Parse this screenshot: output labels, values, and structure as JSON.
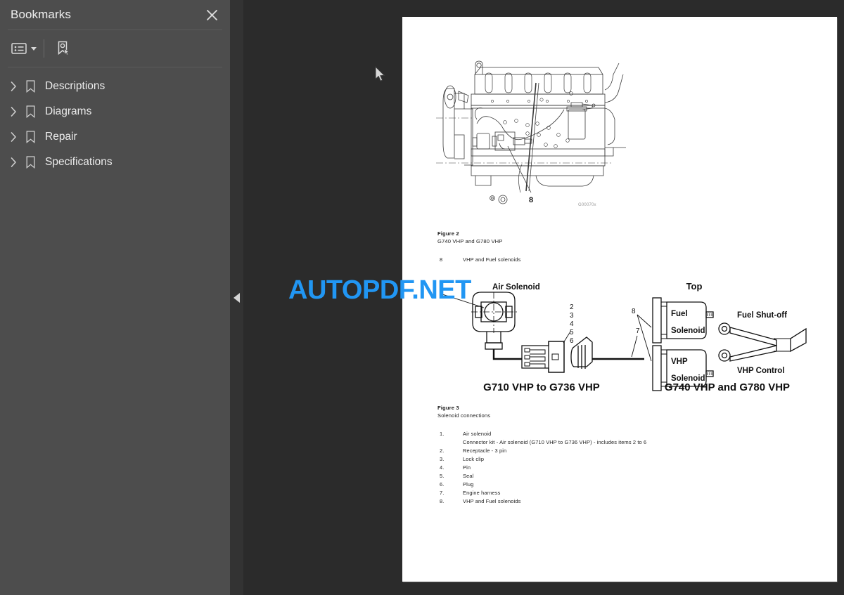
{
  "sidebar": {
    "title": "Bookmarks",
    "close_icon": "close-icon",
    "toolbar": {
      "options_icon": "list-options-icon",
      "options_caret_icon": "chevron-down-icon",
      "new_bookmark_icon": "new-bookmark-icon"
    },
    "items": [
      {
        "label": "Descriptions",
        "expand_icon": "chevron-right-icon",
        "item_icon": "bookmark-icon"
      },
      {
        "label": "Diagrams",
        "expand_icon": "chevron-right-icon",
        "item_icon": "bookmark-icon"
      },
      {
        "label": "Repair",
        "expand_icon": "chevron-right-icon",
        "item_icon": "bookmark-icon"
      },
      {
        "label": "Specifications",
        "expand_icon": "chevron-right-icon",
        "item_icon": "bookmark-icon"
      }
    ]
  },
  "splitter": {
    "collapse_icon": "triangle-left-icon"
  },
  "viewer": {
    "cursor_icon": "arrow-cursor",
    "watermark": "AUTOPDF.NET",
    "watermark_color": "#2196f3",
    "page": {
      "engine_figure": {
        "callout": "8",
        "code": "G00070x"
      },
      "figure2": {
        "title": "Figure 2",
        "subtitle": "G740 VHP and G780 VHP",
        "item_number": "8",
        "item_label": "VHP and Fuel solenoids"
      },
      "solenoid_figure": {
        "left_title": "G710 VHP to G736 VHP",
        "right_title": "G740 VHP and G780 VHP",
        "labels": {
          "air_solenoid": "Air Solenoid",
          "top": "Top",
          "fuel_solenoid_line1": "Fuel",
          "fuel_solenoid_line2": "Solenoid",
          "vhp_solenoid_line1": "VHP",
          "vhp_solenoid_line2": "Solenoid",
          "fuel_shutoff": "Fuel Shut-off",
          "vhp_control": "VHP Control"
        },
        "callouts": [
          "2",
          "3",
          "4",
          "5",
          "6",
          "7",
          "8"
        ]
      },
      "figure3": {
        "title": "Figure 3",
        "subtitle": "Solenoid connections",
        "items": [
          {
            "num": "1.",
            "text": "Air solenoid",
            "subtext": "Connector kit - Air solenoid (G710 VHP to G736 VHP) - includes items 2 to 6"
          },
          {
            "num": "2.",
            "text": "Receptacle - 3 pin"
          },
          {
            "num": "3.",
            "text": "Lock clip"
          },
          {
            "num": "4.",
            "text": "Pin"
          },
          {
            "num": "5.",
            "text": "Seal"
          },
          {
            "num": "6.",
            "text": "Plug"
          },
          {
            "num": "7.",
            "text": "Engine harness"
          },
          {
            "num": "8.",
            "text": "VHP and Fuel solenoids"
          }
        ]
      }
    }
  },
  "colors": {
    "sidebar_bg": "#4d4d4d",
    "viewer_bg": "#2b2b2b",
    "splitter_bg": "#333333",
    "page_bg": "#ffffff",
    "accent": "#2196f3"
  }
}
